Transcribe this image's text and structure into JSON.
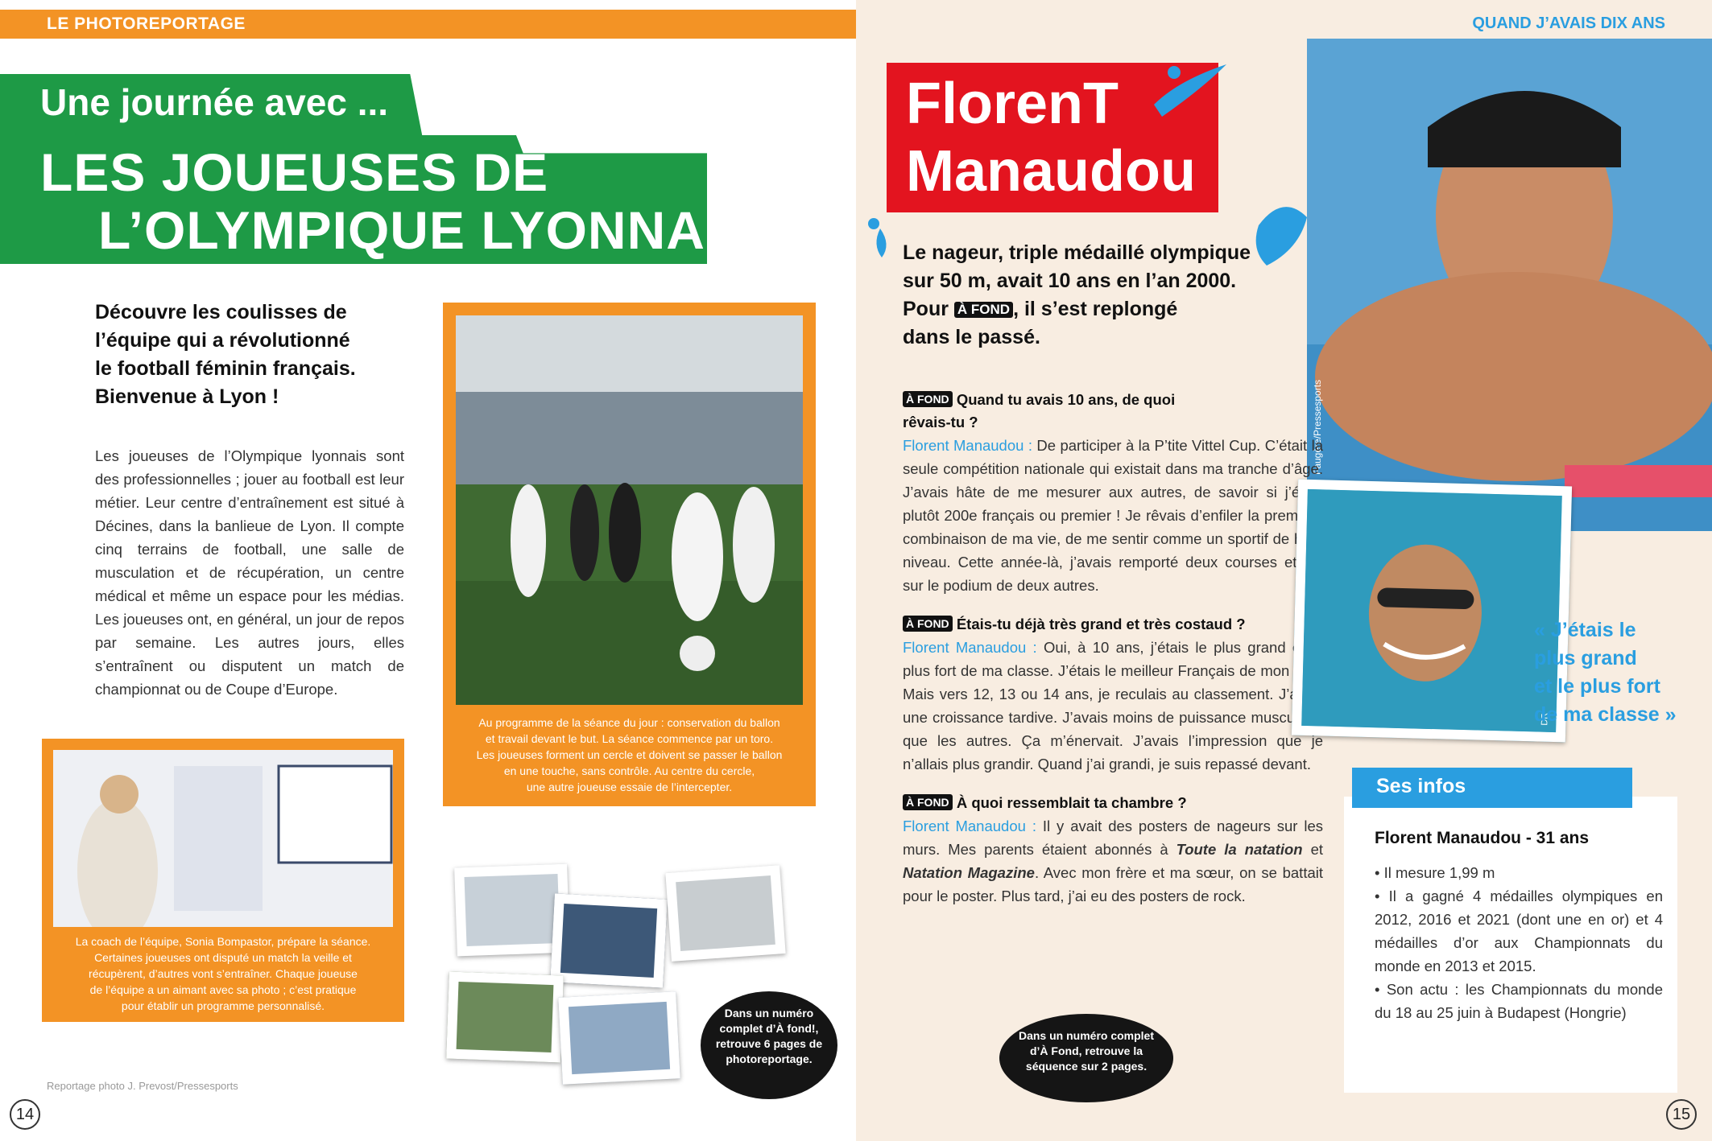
{
  "left": {
    "section_label": "LE PHOTOREPORTAGE",
    "title_small": "Une journée avec ...",
    "title_line1": "LES JOUEUSES DE",
    "title_line2": "L’OLYMPIQUE LYONNAIS",
    "intro": [
      "Découvre les coulisses de",
      "l’équipe qui a révolutionné",
      "le football féminin français.",
      "Bienvenue à Lyon !"
    ],
    "body": "Les joueuses de l’Olympique lyonnais sont des professionnelles ; jouer au football est leur métier. Leur centre d’entraînement est situé à Décines, dans la banlieue de Lyon. Il compte cinq terrains de football, une salle de musculation et de récupération, un centre médical et même un espace pour les médias. Les joueuses ont, en général, un jour de repos par semaine. Les autres jours, elles s’entraînent ou disputent un match de championnat ou de Coupe d’Europe.",
    "caption_main": [
      "Au programme de la séance du jour : conservation du ballon",
      "et travail devant le but. La séance commence par un toro.",
      "Les joueuses forment un cercle et doivent se passer le ballon",
      "en une touche, sans contrôle. Au centre du cercle,",
      "une autre joueuse essaie de l’intercepter."
    ],
    "caption_coach": [
      "La coach de l’équipe, Sonia Bompastor, prépare la séance.",
      "Certaines joueuses ont disputé un match la veille et",
      "récupèrent, d’autres vont s’entraîner. Chaque joueuse",
      "de l’équipe a un aimant avec sa photo ; c’est pratique",
      "pour établir un programme personnalisé."
    ],
    "blob": [
      "Dans un numéro",
      "complet d’À fond!,",
      "retrouve 6 pages de",
      "photoreportage."
    ],
    "credit": "Reportage photo J. Prevost/Pressesports",
    "page_number": "14"
  },
  "right": {
    "section_label": "QUAND J’AVAIS DIX ANS",
    "name_line1": "FlorenT",
    "name_line2": "Manaudou",
    "intro": [
      "Le nageur, triple médaillé olympique",
      "sur 50 m, avait 10 ans en l’an 2000.",
      "Pour",
      "À FOND",
      ", il s’est replongé",
      "dans le passé."
    ],
    "fond_label": "À FOND",
    "q1": [
      "Quand tu avais 10 ans, de quoi",
      "rêvais-tu ?"
    ],
    "speaker": "Florent Manaudou :",
    "a1": "De participer à la P’tite Vittel Cup. C’était la seule compétition nationale qui existait dans ma tranche d’âge. J’avais hâte de me mesurer aux autres, de savoir si j’étais plutôt 200e français ou premier ! Je rêvais d’enfiler la première combinaison de ma vie, de me sentir comme un sportif de haut niveau. Cette année-là, j’avais remporté deux courses et fini sur le podium de deux autres.",
    "q2": "Étais-tu déjà très grand et très costaud ?",
    "a2": "Oui, à 10 ans, j’étais le plus grand et le plus fort de ma classe. J’étais le meilleur Français de mon âge. Mais vers 12, 13 ou 14 ans, je reculais au classement. J’ai eu une croissance tardive. J’avais moins de puissance musculaire que les autres. Ça m’énervait. J’avais l’impression que je n’allais plus grandir. Quand j’ai grandi, je suis repassé devant.",
    "q3": "À quoi ressemblait ta chambre ?",
    "a3_part1": "Il y avait des posters de nageurs sur les murs. Mes parents étaient abonnés à",
    "a3_mag1": "Toute la natation",
    "a3_and": "et",
    "a3_mag2": "Natation Magazine",
    "a3_part2": ". Avec mon frère et ma sœur, on se battait pour le poster. Plus tard, j’ai eu des posters de rock.",
    "quote": [
      "« J’étais le",
      "plus grand",
      "et le plus fort",
      "de ma classe »"
    ],
    "photo_credit": "Faugère/Pressesports",
    "child_credit": "DR",
    "infos_title": "Ses infos",
    "infos_name": "Florent Manaudou - 31 ans",
    "infos_items": [
      "• Il mesure 1,99 m",
      "• Il a gagné 4 médailles olympiques en 2012, 2016 et 2021 (dont une en or) et 4 médailles d’or aux Championnats du monde en 2013 et 2015.",
      "• Son actu : les Championnats du monde du 18 au 25 juin à Budapest (Hongrie)"
    ],
    "blob": [
      "Dans un numéro complet",
      "d’À Fond, retrouve la",
      "séquence sur 2 pages."
    ],
    "page_number": "15"
  },
  "colors": {
    "orange": "#f39325",
    "green": "#1e9a46",
    "red": "#e3141f",
    "blue": "#2a9ee0",
    "cream": "#f8ede1"
  }
}
